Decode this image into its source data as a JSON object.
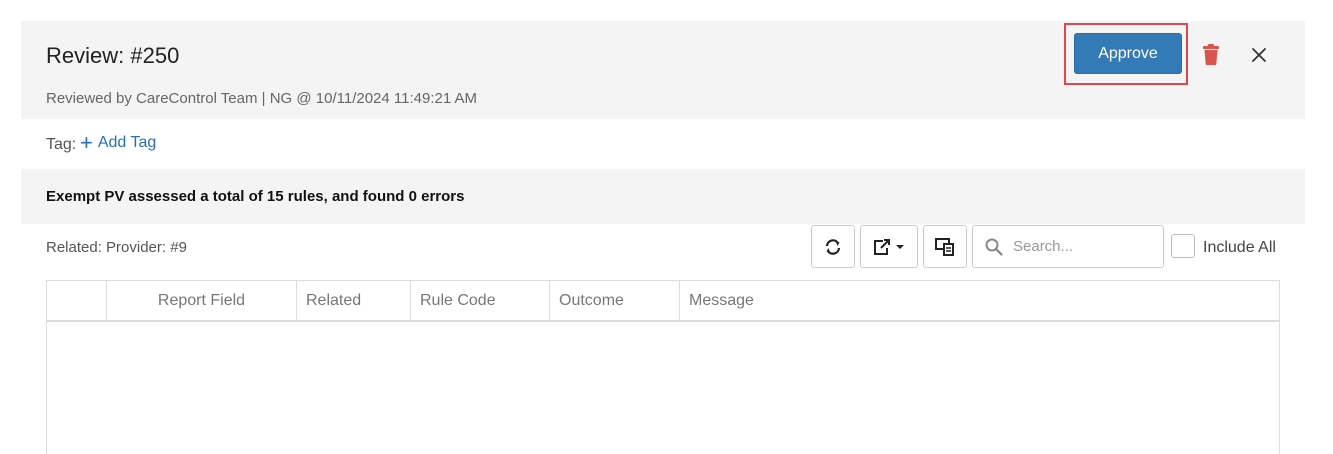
{
  "header": {
    "title": "Review: #250",
    "subtitle": "Reviewed by CareControl Team | NG @ 10/11/2024 11:49:21 AM",
    "approve_label": "Approve"
  },
  "tag": {
    "label": "Tag:",
    "add_label": "Add Tag"
  },
  "summary": {
    "text": "Exempt PV assessed a total of 15 rules, and found 0 errors"
  },
  "toolbar": {
    "related": "Related: Provider: #9",
    "search_placeholder": "Search...",
    "include_all_label": "Include All"
  },
  "table": {
    "columns": [
      "",
      "Report Field",
      "Related",
      "Rule Code",
      "Outcome",
      "Message"
    ],
    "rows": []
  },
  "colors": {
    "primary": "#337ab7",
    "danger": "#d9534f",
    "highlight": "#e0474c",
    "link": "#2a6fb3"
  },
  "icons": [
    "trash-icon",
    "close-icon",
    "plus-icon",
    "refresh-icon",
    "export-icon",
    "columns-icon",
    "search-icon"
  ]
}
